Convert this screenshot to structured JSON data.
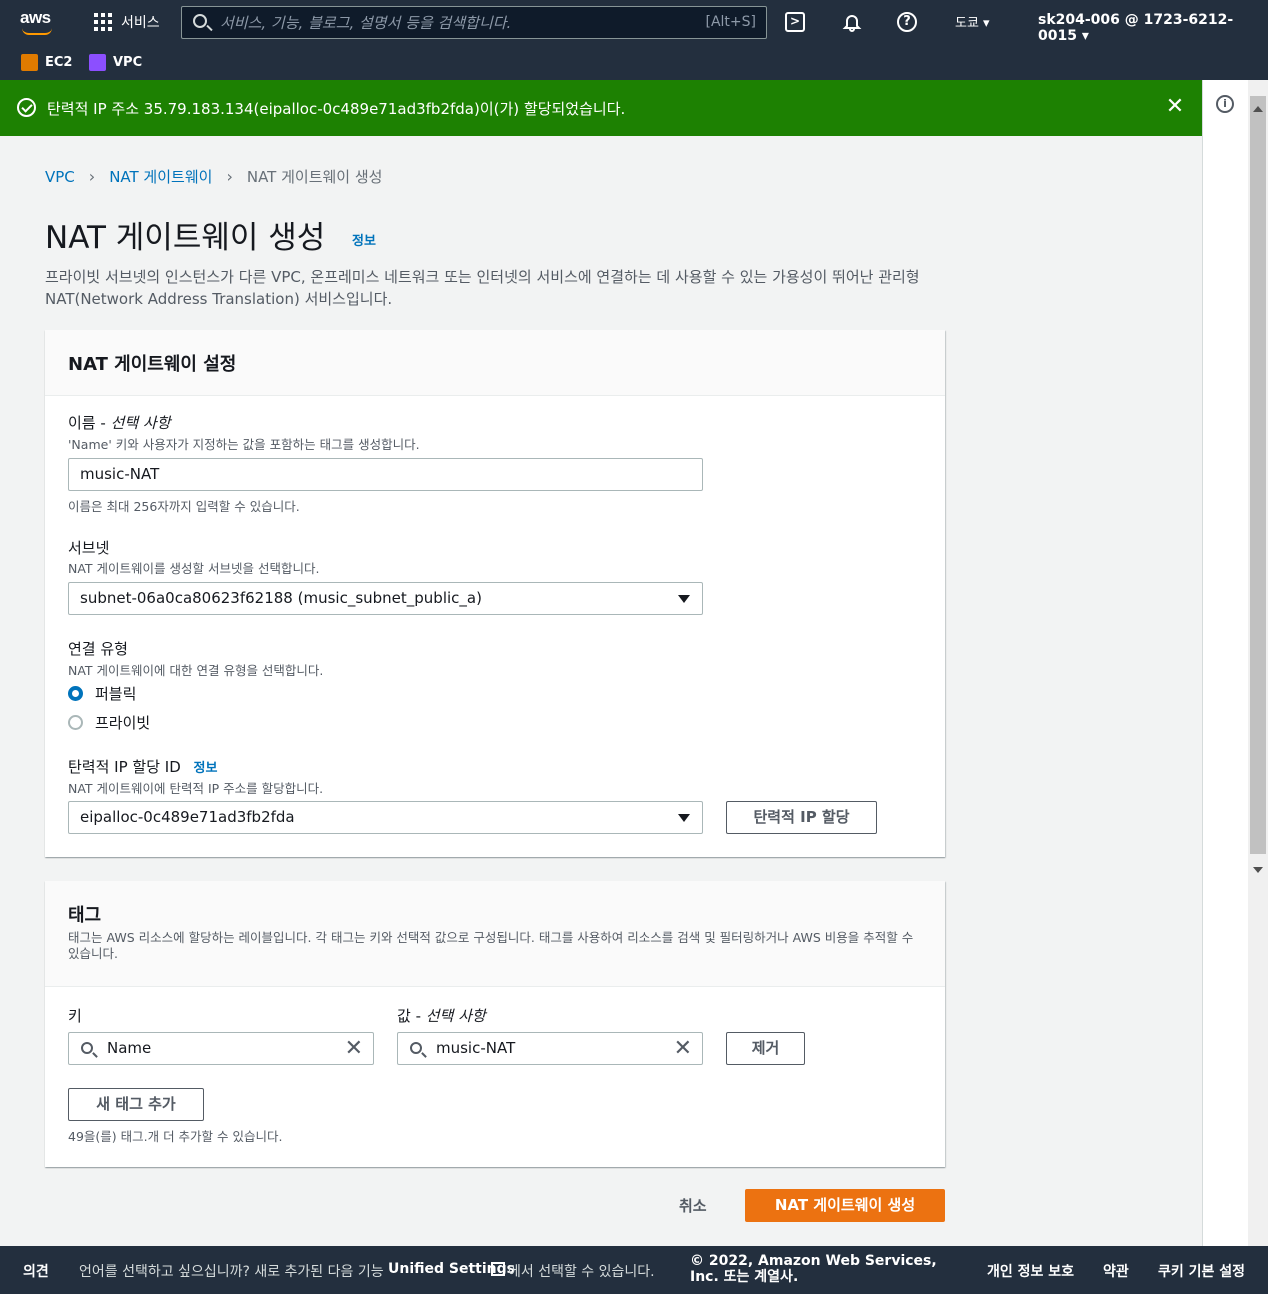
{
  "topnav": {
    "logo": "aws",
    "services_label": "서비스",
    "search_placeholder": "서비스, 기능, 블로그, 설명서 등을 검색합니다.",
    "search_shortcut": "[Alt+S]",
    "region": "도쿄 ▾",
    "account": "sk204-006 @ 1723-6212-0015 ▾",
    "favorites": [
      {
        "label": "EC2",
        "icon": "ec2-icon",
        "color": "#e07b00"
      },
      {
        "label": "VPC",
        "icon": "vpc-icon",
        "color": "#8c4fff"
      }
    ]
  },
  "flash": {
    "message": "탄력적 IP 주소 35.79.183.134(eipalloc-0c489e71ad3fb2fda)이(가) 할당되었습니다.",
    "color": "#1d8102"
  },
  "breadcrumb": {
    "items": [
      "VPC",
      "NAT 게이트웨이"
    ],
    "current": "NAT 게이트웨이 생성"
  },
  "page": {
    "title": "NAT 게이트웨이 생성",
    "info_link": "정보",
    "description": "프라이빗 서브넷의 인스턴스가 다른 VPC, 온프레미스 네트워크 또는 인터넷의 서비스에 연결하는 데 사용할 수 있는 가용성이 뛰어난 관리형 NAT(Network Address Translation) 서비스입니다."
  },
  "settings": {
    "title": "NAT 게이트웨이 설정",
    "name_label": "이름 - ",
    "name_optional": "선택 사항",
    "name_hint": "'Name' 키와 사용자가 지정하는 값을 포함하는 태그를 생성합니다.",
    "name_value": "music-NAT",
    "name_constraint": "이름은 최대 256자까지 입력할 수 있습니다.",
    "subnet_label": "서브넷",
    "subnet_hint": "NAT 게이트웨이를 생성할 서브넷을 선택합니다.",
    "subnet_value": "subnet-06a0ca80623f62188 (music_subnet_public_a)",
    "conn_label": "연결 유형",
    "conn_hint": "NAT 게이트웨이에 대한 연결 유형을 선택합니다.",
    "conn_options": [
      "퍼블릭",
      "프라이빗"
    ],
    "conn_selected": "퍼블릭",
    "eip_label": "탄력적 IP 할당 ID",
    "eip_info": "정보",
    "eip_hint": "NAT 게이트웨이에 탄력적 IP 주소를 할당합니다.",
    "eip_value": "eipalloc-0c489e71ad3fb2fda",
    "eip_button": "탄력적 IP 할당"
  },
  "tags": {
    "title": "태그",
    "description": "태그는 AWS 리소스에 할당하는 레이블입니다. 각 태그는 키와 선택적 값으로 구성됩니다. 태그를 사용하여 리소스를 검색 및 필터링하거나 AWS 비용을 추적할 수 있습니다.",
    "key_label": "키",
    "value_label": "값 - ",
    "value_optional": "선택 사항",
    "key_value": "Name",
    "value_value": "music-NAT",
    "remove_button": "제거",
    "add_button": "새 태그 추가",
    "remaining": "49을(를) 태그.개 더 추가할 수 있습니다."
  },
  "actions": {
    "cancel": "취소",
    "create": "NAT 게이트웨이 생성",
    "create_color": "#ec7211"
  },
  "footer": {
    "feedback": "의견",
    "lang_text": "언어를 선택하고 싶으십니까? 새로 추가된 다음 기능",
    "unified_settings": "Unified Settings",
    "lang_text2": "에서 선택할 수 있습니다.",
    "copyright": "© 2022, Amazon Web Services, Inc. 또는 계열사.",
    "privacy": "개인 정보 보호",
    "terms": "약관",
    "cookies": "쿠키 기본 설정"
  }
}
